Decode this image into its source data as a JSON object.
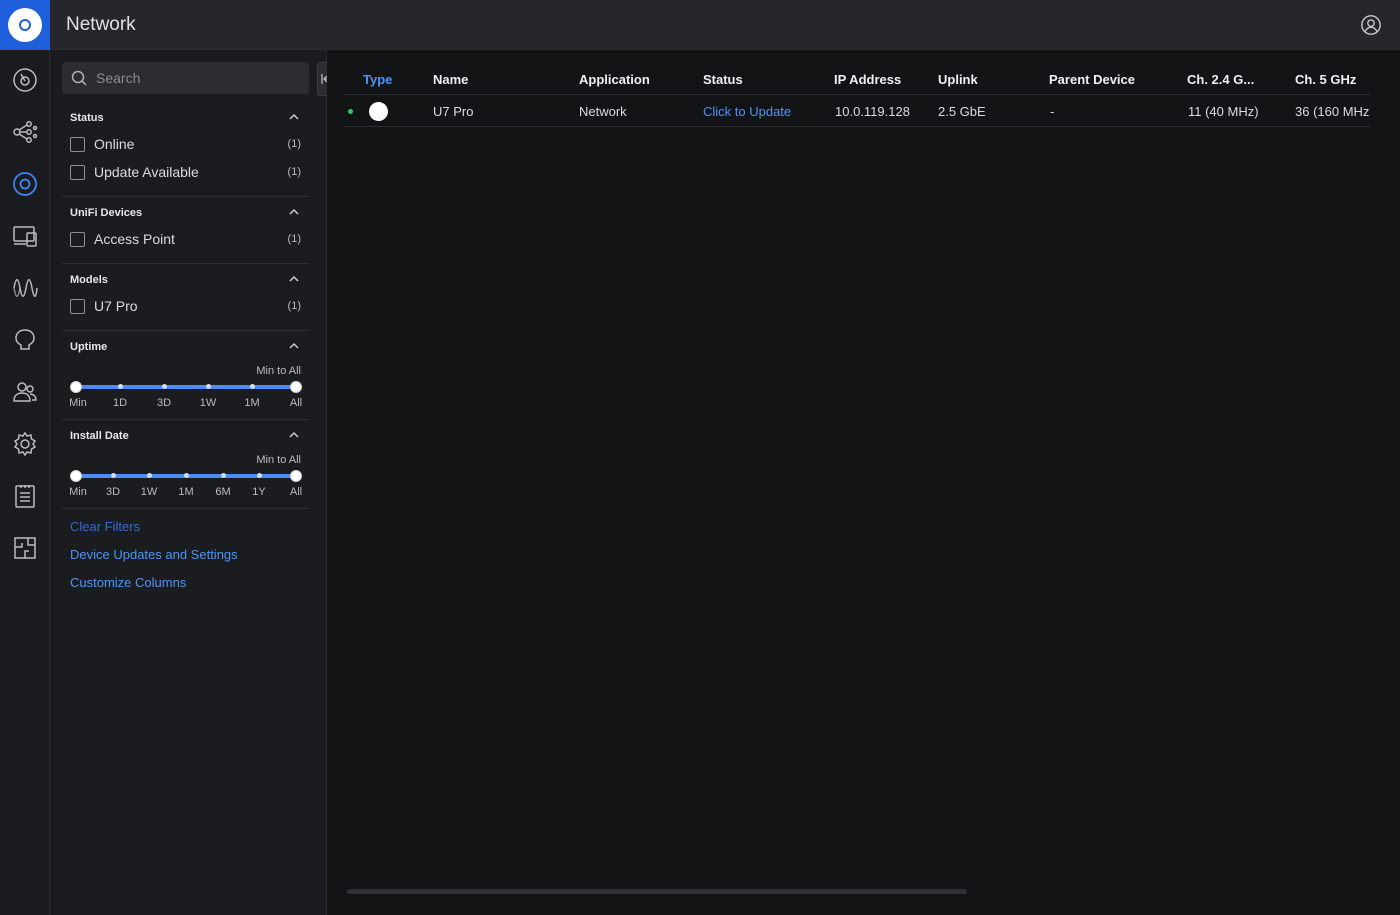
{
  "header": {
    "title": "Network"
  },
  "rail": {
    "items": [
      {
        "name": "dashboard-icon",
        "active": false
      },
      {
        "name": "topology-icon",
        "active": false
      },
      {
        "name": "unifi-devices-icon",
        "active": true
      },
      {
        "name": "client-devices-icon",
        "active": false
      },
      {
        "name": "insights-icon",
        "active": false
      },
      {
        "name": "radio-manager-icon",
        "active": false
      },
      {
        "name": "admins-users-icon",
        "active": false
      },
      {
        "name": "settings-icon",
        "active": false
      },
      {
        "name": "logs-icon",
        "active": false
      },
      {
        "name": "floorplan-icon",
        "active": false
      }
    ]
  },
  "filters": {
    "search_placeholder": "Search",
    "status": {
      "title": "Status",
      "items": [
        {
          "label": "Online",
          "count": "(1)"
        },
        {
          "label": "Update Available",
          "count": "(1)"
        }
      ]
    },
    "unifi_devices": {
      "title": "UniFi Devices",
      "items": [
        {
          "label": "Access Point",
          "count": "(1)"
        }
      ]
    },
    "models": {
      "title": "Models",
      "items": [
        {
          "label": "U7 Pro",
          "count": "(1)"
        }
      ]
    },
    "uptime": {
      "title": "Uptime",
      "range_note": "Min to All",
      "ticks": [
        "Min",
        "1D",
        "3D",
        "1W",
        "1M",
        "All"
      ]
    },
    "install_date": {
      "title": "Install Date",
      "range_note": "Min to All",
      "ticks": [
        "Min",
        "3D",
        "1W",
        "1M",
        "6M",
        "1Y",
        "All"
      ]
    },
    "links": {
      "clear": "Clear Filters",
      "device_updates": "Device Updates and Settings",
      "customize": "Customize Columns"
    }
  },
  "table": {
    "columns": [
      "Type",
      "Name",
      "Application",
      "Status",
      "IP Address",
      "Uplink",
      "Parent Device",
      "Ch. 2.4 G...",
      "Ch. 5 GHz"
    ],
    "rows": [
      {
        "name": "U7 Pro",
        "application": "Network",
        "status": "Click to Update",
        "ip": "10.0.119.128",
        "uplink": "2.5 GbE",
        "parent": "-",
        "ch24": "11 (40 MHz)",
        "ch5": "36 (160 MHz"
      }
    ]
  },
  "colors": {
    "accent": "#4b95f7",
    "brand": "#1f5fdb",
    "online": "#39c26b",
    "background": "#131416",
    "panel": "#1b1c1f"
  }
}
